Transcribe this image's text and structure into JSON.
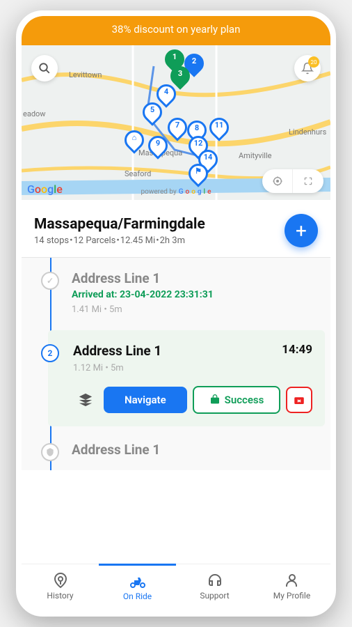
{
  "banner": {
    "text": "38% discount on yearly plan"
  },
  "map": {
    "notif_count": "20",
    "labels": {
      "levittown": "Levittown",
      "meadow": "eadow",
      "massapequa": "Massapequa",
      "seaford": "Seaford",
      "amityville": "Amityville",
      "lindenhurst": "Lindenhurs"
    },
    "logo": [
      "G",
      "o",
      "o",
      "g",
      "l",
      "e"
    ],
    "powered": "powered by",
    "pins": {
      "p1": "1",
      "p2": "2",
      "p3": "3",
      "p4": "4",
      "p5": "5",
      "p7": "7",
      "p8": "8",
      "p9": "9",
      "p11": "11",
      "p12": "12",
      "p14": "14"
    }
  },
  "route": {
    "title": "Massapequa/Farmingdale",
    "stops": "14 stops",
    "parcels": "12 Parcels",
    "distance": "12.45 Mi",
    "duration": "2h 3m"
  },
  "stops": [
    {
      "title": "Address Line 1",
      "arrived": "Arrived at: 23-04-2022 23:31:31",
      "meta_dist": "1.41 Mi",
      "meta_time": "5m"
    },
    {
      "num": "2",
      "title": "Address Line 1",
      "time": "14:49",
      "meta_dist": "1.12 Mi",
      "meta_time": "5m"
    },
    {
      "title": "Address Line 1"
    }
  ],
  "actions": {
    "navigate": "Navigate",
    "success": "Success"
  },
  "tabs": {
    "history": "History",
    "onride": "On Ride",
    "support": "Support",
    "profile": "My Profile"
  }
}
